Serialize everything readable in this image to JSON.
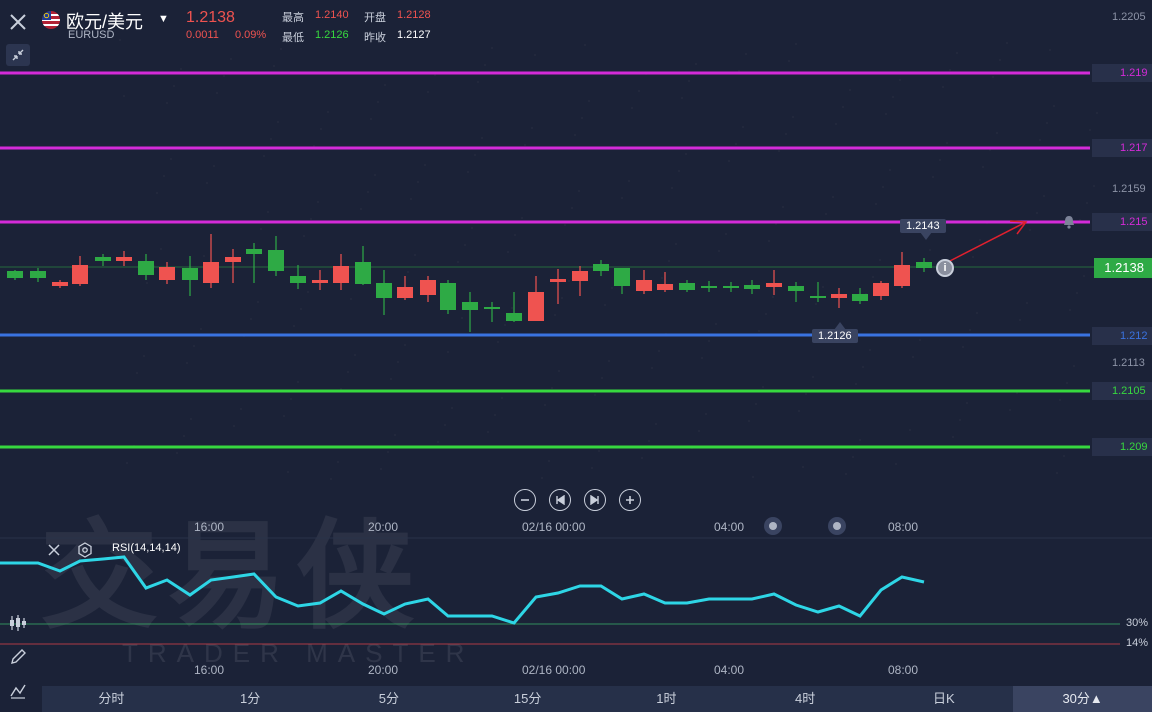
{
  "header": {
    "pair_name": "欧元/美元",
    "pair_code": "EURUSD",
    "last_price": "1.2138",
    "change": "0.0011",
    "change_pct": "0.09%",
    "stats": {
      "high_label": "最高",
      "high": "1.2140",
      "open_label": "开盘",
      "open": "1.2128",
      "low_label": "最低",
      "low": "1.2126",
      "prev_close_label": "昨收",
      "prev_close": "1.2127"
    }
  },
  "price_axis": {
    "top_tick": "1.2205",
    "ticks": [
      "1.2159",
      "1.2113"
    ],
    "current_price_tag": "1.2138"
  },
  "levels": [
    {
      "label": "1.219",
      "color": "#d42bd8"
    },
    {
      "label": "1.217",
      "color": "#d42bd8"
    },
    {
      "label": "1.215",
      "color": "#d42bd8"
    },
    {
      "label": "1.212",
      "color": "#3a73e0"
    },
    {
      "label": "1.2105",
      "color": "#37d83f"
    },
    {
      "label": "1.209",
      "color": "#37d83f"
    }
  ],
  "markers": {
    "high_marker": "1.2143",
    "low_marker": "1.2126"
  },
  "navigation": {
    "zoom_out": "−",
    "prev": "⏮",
    "next": "⏭",
    "zoom_in": "+"
  },
  "time_axis": {
    "labels": [
      "16:00",
      "20:00",
      "02/16 00:00",
      "04:00",
      "08:00"
    ]
  },
  "rsi": {
    "label": "RSI(14,14,14)",
    "levels": [
      "30%",
      "14%"
    ]
  },
  "watermark": {
    "text": "交易侠",
    "sub": "TRADER MASTER"
  },
  "timeframes": [
    {
      "label": "分时",
      "active": false
    },
    {
      "label": "1分",
      "active": false
    },
    {
      "label": "5分",
      "active": false
    },
    {
      "label": "15分",
      "active": false
    },
    {
      "label": "1时",
      "active": false
    },
    {
      "label": "4时",
      "active": false
    },
    {
      "label": "日K",
      "active": false
    },
    {
      "label": "30分▲",
      "active": true
    }
  ],
  "colors": {
    "up": "#2eaa45",
    "down": "#ef5350",
    "rsi_line": "#2ed6e6",
    "background": "#1b2237"
  },
  "icons": {
    "close": "close-icon",
    "collapse": "collapse-arrows-icon",
    "flag": "eu-us-flag-icon",
    "caret": "caret-down-icon",
    "bell": "bell-icon",
    "info": "info-icon",
    "indicator": "candlestick-icon",
    "pencil": "pencil-icon",
    "line_tool": "trendline-icon",
    "gear": "gear-icon"
  }
}
